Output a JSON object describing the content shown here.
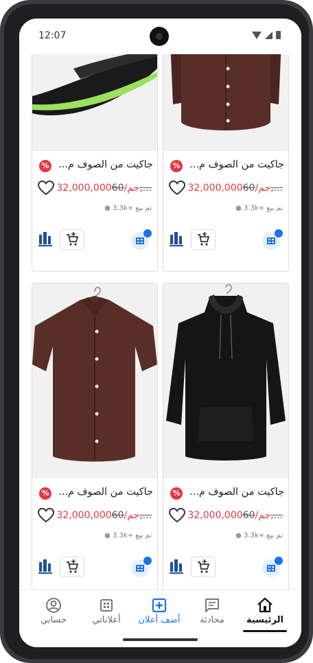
{
  "status_bar": {
    "time": "12:07"
  },
  "products": [
    {
      "title": "جاكيت من الصوف م...",
      "discount_badge": "%",
      "price": "32,000,000جم/",
      "old_price": "60,...",
      "sold": "تم بيع +3.3k",
      "image": "black-green-sneaker"
    },
    {
      "title": "جاكيت من الصوف م...",
      "discount_badge": "%",
      "price": "32,000,000جم/",
      "old_price": "60,...",
      "sold": "تم بيع +3.3k",
      "image": "brown-shirt"
    },
    {
      "title": "جاكيت من الصوف م...",
      "discount_badge": "%",
      "price": "32,000,000جم/",
      "old_price": "60,...",
      "sold": "تم بيع +3.3k",
      "image": "brown-shirt-hanger"
    },
    {
      "title": "جاكيت من الصوف م...",
      "discount_badge": "%",
      "price": "32,000,000جم/",
      "old_price": "60,...",
      "sold": "تم بيع +3.3k",
      "image": "black-hoodie-hanger"
    }
  ],
  "nav": [
    {
      "label": "حسابي",
      "icon": "account-circle-icon"
    },
    {
      "label": "أعلاناتي",
      "icon": "grid-icon"
    },
    {
      "label": "أضف أعلان",
      "icon": "add-box-icon"
    },
    {
      "label": "محادثة",
      "icon": "chat-icon"
    },
    {
      "label": "الرئيسية",
      "icon": "home-icon"
    }
  ],
  "colors": {
    "accent": "#1a73e8",
    "sale": "#e23744",
    "active_nav": "#111111"
  }
}
